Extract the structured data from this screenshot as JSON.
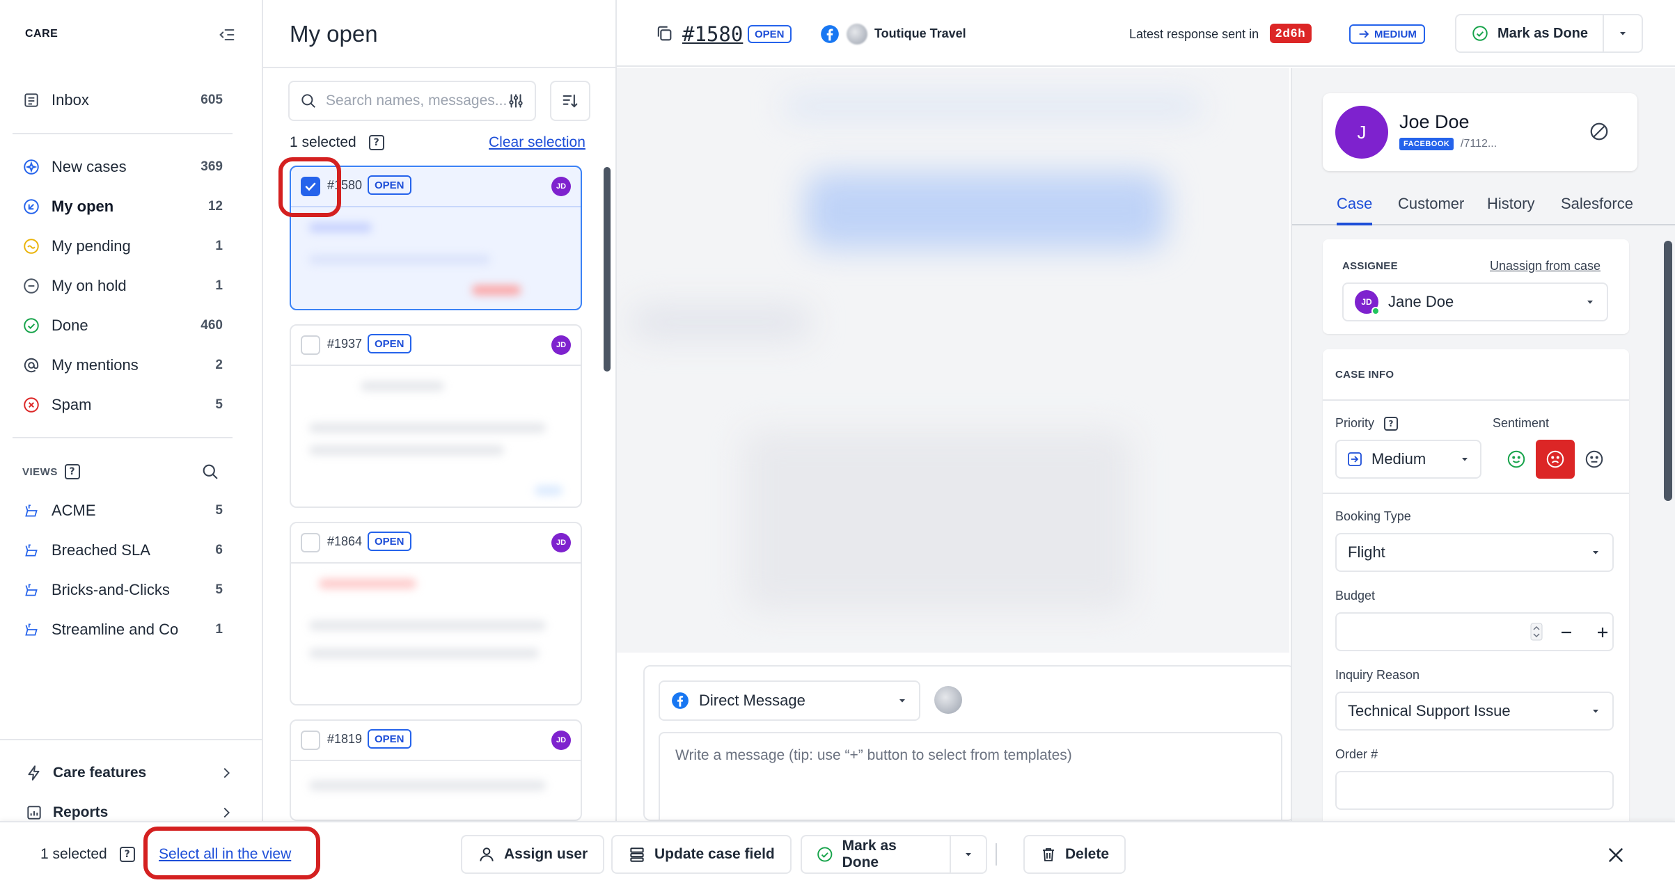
{
  "sidebar": {
    "brand": "CARE",
    "items": [
      {
        "label": "Inbox",
        "count": "605",
        "icon": "inbox-icon"
      },
      {
        "label": "New cases",
        "count": "369",
        "icon": "new-cases-icon"
      },
      {
        "label": "My open",
        "count": "12",
        "icon": "my-open-icon"
      },
      {
        "label": "My pending",
        "count": "1",
        "icon": "pending-icon"
      },
      {
        "label": "My on hold",
        "count": "1",
        "icon": "on-hold-icon"
      },
      {
        "label": "Done",
        "count": "460",
        "icon": "check-circle-icon"
      },
      {
        "label": "My mentions",
        "count": "2",
        "icon": "at-icon"
      },
      {
        "label": "Spam",
        "count": "5",
        "icon": "spam-icon"
      }
    ],
    "views_label": "VIEWS",
    "views": [
      {
        "label": "ACME",
        "count": "5"
      },
      {
        "label": "Breached SLA",
        "count": "6"
      },
      {
        "label": "Bricks-and-Clicks",
        "count": "5"
      },
      {
        "label": "Streamline and Co",
        "count": "1"
      }
    ],
    "footer": [
      {
        "label": "Care features",
        "icon": "bolt-icon"
      },
      {
        "label": "Reports",
        "icon": "reports-icon"
      }
    ]
  },
  "list": {
    "title": "My open",
    "search_placeholder": "Search names, messages...",
    "selected_count": "1 selected",
    "clear_selection": "Clear selection",
    "cards": [
      {
        "id": "#1580",
        "status": "OPEN",
        "assignee": "JD",
        "selected": true
      },
      {
        "id": "#1937",
        "status": "OPEN",
        "assignee": "JD",
        "selected": false
      },
      {
        "id": "#1864",
        "status": "OPEN",
        "assignee": "JD",
        "selected": false
      },
      {
        "id": "#1819",
        "status": "OPEN",
        "assignee": "JD",
        "selected": false
      }
    ]
  },
  "topbar": {
    "case_id": "#1580",
    "status": "OPEN",
    "brand": "Toutique Travel",
    "latest_response_label": "Latest response sent in",
    "latest_response_time": "2d6h",
    "priority": "MEDIUM",
    "mark_done": "Mark as Done"
  },
  "composer": {
    "channel": "Direct Message",
    "placeholder": "Write a message (tip: use “+” button to select from templates)"
  },
  "contact": {
    "initial": "J",
    "name": "Joe Doe",
    "network": "FACEBOOK",
    "handle": "/7112..."
  },
  "tabs": [
    "Case",
    "Customer",
    "History",
    "Salesforce"
  ],
  "case_panel": {
    "assignee_label": "ASSIGNEE",
    "unassign": "Unassign from case",
    "assignee_name": "Jane Doe",
    "assignee_initials": "JD",
    "case_info_label": "CASE INFO",
    "priority_label": "Priority",
    "priority_value": "Medium",
    "sentiment_label": "Sentiment",
    "sentiment_selected": "negative",
    "booking_type_label": "Booking Type",
    "booking_type_value": "Flight",
    "budget_label": "Budget",
    "inquiry_reason_label": "Inquiry Reason",
    "inquiry_reason_value": "Technical Support Issue",
    "order_label": "Order #"
  },
  "bulkbar": {
    "selected": "1 selected",
    "select_all": "Select all in the view",
    "assign_user": "Assign user",
    "update_field": "Update case field",
    "mark_done": "Mark as Done",
    "delete": "Delete"
  },
  "colors": {
    "accent": "#1d4ed8",
    "danger": "#dc2626",
    "avatar": "#7e22ce",
    "highlight": "#d42020"
  }
}
